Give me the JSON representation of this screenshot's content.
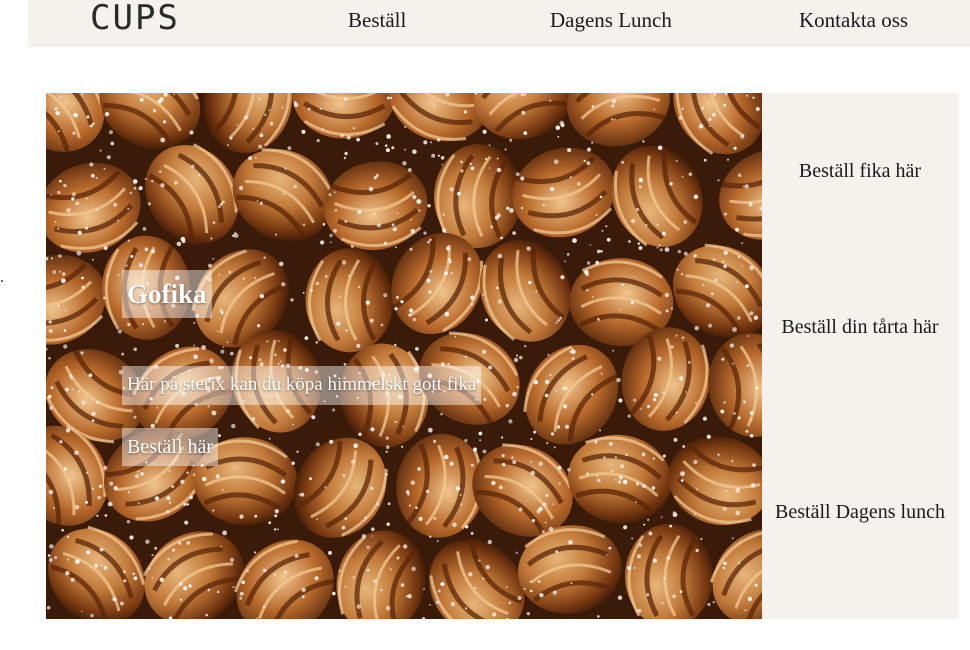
{
  "header": {
    "logo": "CUPS",
    "nav": [
      {
        "label": "Beställ"
      },
      {
        "label": "Dagens Lunch"
      },
      {
        "label": "Kontakta oss"
      }
    ]
  },
  "hero": {
    "image_subject": "kanelbullar",
    "title": "Gofika",
    "tagline": "Här på sterix kan du köpa himmelskt gott fika",
    "cta_label": "Beställ här"
  },
  "sidebar": {
    "links": [
      {
        "label": "Beställ fika här"
      },
      {
        "label": "Beställ din tårta här"
      },
      {
        "label": "Beställ Dagens lunch"
      }
    ]
  },
  "colors": {
    "nav_background": "#f5f1ed",
    "sidebar_background": "#f5f1ed",
    "overlay_background": "rgba(255,255,255,0.45)",
    "text": "#1a1a1a"
  }
}
